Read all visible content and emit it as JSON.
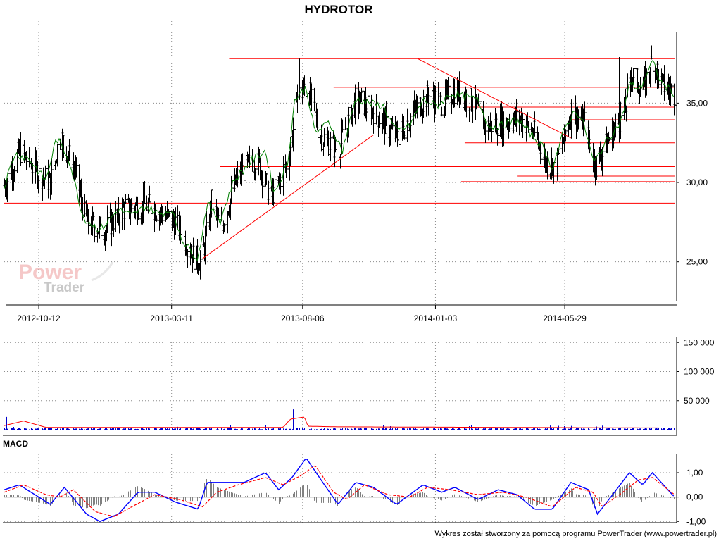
{
  "title": "HYDROTOR",
  "watermark": {
    "brand_top": "Power",
    "brand_bottom": "Trader"
  },
  "footer": "Wykres został stworzony za pomocą programu PowerTrader (www.powertrader.pl)",
  "colors": {
    "trendline": "#ff0000",
    "moving_average": "#008000",
    "bars": "#000000",
    "volume_bars": "#0000cc",
    "volume_average": "#ff0000",
    "macd_line": "#0000ff",
    "macd_signal": "#ff0000",
    "macd_histogram": "#808080"
  },
  "chart_data": [
    {
      "type": "ohlc",
      "title": "HYDROTOR",
      "x_tick_labels": [
        "2012-10-12",
        "2013-03-11",
        "2013-08-06",
        "2014-01-03",
        "2014-05-29"
      ],
      "date_range": [
        "2012-09-03",
        "2014-09-30"
      ],
      "y_tick_labels": [
        "25,00",
        "30,00",
        "35,00"
      ],
      "ylim": [
        22.5,
        39.5
      ],
      "grid": true,
      "moving_average_close": [
        [
          "2012-09-03",
          29.8
        ],
        [
          "2012-09-15",
          31.8
        ],
        [
          "2012-10-01",
          31.5
        ],
        [
          "2012-10-20",
          30.1
        ],
        [
          "2012-11-01",
          32.8
        ],
        [
          "2012-11-15",
          31.5
        ],
        [
          "2012-12-01",
          27.8
        ],
        [
          "2012-12-20",
          27.0
        ],
        [
          "2013-01-10",
          28.3
        ],
        [
          "2013-01-25",
          27.9
        ],
        [
          "2013-02-10",
          28.5
        ],
        [
          "2013-02-25",
          28.0
        ],
        [
          "2013-03-10",
          28.3
        ],
        [
          "2013-03-25",
          26.2
        ],
        [
          "2013-04-10",
          25.2
        ],
        [
          "2013-04-20",
          28.7
        ],
        [
          "2013-05-05",
          27.6
        ],
        [
          "2013-05-20",
          30.1
        ],
        [
          "2013-06-10",
          31.4
        ],
        [
          "2013-06-25",
          32.0
        ],
        [
          "2013-07-05",
          29.3
        ],
        [
          "2013-07-20",
          31.2
        ],
        [
          "2013-07-28",
          35.2
        ],
        [
          "2013-08-10",
          36.0
        ],
        [
          "2013-08-20",
          33.1
        ],
        [
          "2013-09-05",
          33.8
        ],
        [
          "2013-09-20",
          32.0
        ],
        [
          "2013-10-05",
          35.3
        ],
        [
          "2013-10-20",
          35.0
        ],
        [
          "2013-11-05",
          34.8
        ],
        [
          "2013-11-20",
          33.2
        ],
        [
          "2013-12-05",
          33.6
        ],
        [
          "2013-12-20",
          35.2
        ],
        [
          "2014-01-05",
          34.8
        ],
        [
          "2014-01-20",
          35.6
        ],
        [
          "2014-02-05",
          35.4
        ],
        [
          "2014-02-20",
          35.2
        ],
        [
          "2014-03-05",
          33.5
        ],
        [
          "2014-03-20",
          33.6
        ],
        [
          "2014-04-05",
          34.0
        ],
        [
          "2014-04-20",
          33.1
        ],
        [
          "2014-05-05",
          32.2
        ],
        [
          "2014-05-15",
          30.9
        ],
        [
          "2014-05-29",
          33.4
        ],
        [
          "2014-06-10",
          34.6
        ],
        [
          "2014-06-20",
          33.6
        ],
        [
          "2014-07-01",
          31.2
        ],
        [
          "2014-07-15",
          32.6
        ],
        [
          "2014-08-01",
          33.9
        ],
        [
          "2014-08-10",
          36.2
        ],
        [
          "2014-08-22",
          35.9
        ],
        [
          "2014-09-05",
          37.6
        ],
        [
          "2014-09-15",
          36.3
        ],
        [
          "2014-09-30",
          35.6
        ]
      ],
      "ohlc_anchors": [
        [
          "2012-09-03",
          29.8
        ],
        [
          "2012-09-20",
          32.0
        ],
        [
          "2012-10-12",
          30.5
        ],
        [
          "2012-10-25",
          30.0
        ],
        [
          "2012-11-05",
          33.0
        ],
        [
          "2012-11-20",
          31.0
        ],
        [
          "2012-12-05",
          27.5
        ],
        [
          "2012-12-25",
          27.0
        ],
        [
          "2013-01-15",
          28.3
        ],
        [
          "2013-02-10",
          28.6
        ],
        [
          "2013-03-01",
          28.0
        ],
        [
          "2013-03-15",
          27.5
        ],
        [
          "2013-04-05",
          25.3
        ],
        [
          "2013-04-14",
          25.0
        ],
        [
          "2013-04-25",
          28.8
        ],
        [
          "2013-05-05",
          27.0
        ],
        [
          "2013-05-25",
          30.5
        ],
        [
          "2013-06-15",
          31.5
        ],
        [
          "2013-07-01",
          29.0
        ],
        [
          "2013-07-20",
          31.3
        ],
        [
          "2013-08-01",
          35.5
        ],
        [
          "2013-08-12",
          36.0
        ],
        [
          "2013-08-25",
          33.0
        ],
        [
          "2013-09-15",
          32.0
        ],
        [
          "2013-10-05",
          35.3
        ],
        [
          "2013-10-25",
          34.5
        ],
        [
          "2013-11-20",
          32.8
        ],
        [
          "2013-12-10",
          34.5
        ],
        [
          "2013-12-25",
          35.5
        ],
        [
          "2014-01-10",
          35.0
        ],
        [
          "2014-01-25",
          35.8
        ],
        [
          "2014-02-15",
          35.0
        ],
        [
          "2014-03-01",
          33.5
        ],
        [
          "2014-03-20",
          33.8
        ],
        [
          "2014-04-10",
          34.0
        ],
        [
          "2014-04-25",
          33.0
        ],
        [
          "2014-05-10",
          31.0
        ],
        [
          "2014-05-20",
          31.2
        ],
        [
          "2014-06-05",
          34.5
        ],
        [
          "2014-06-20",
          33.8
        ],
        [
          "2014-07-02",
          31.0
        ],
        [
          "2014-07-20",
          33.0
        ],
        [
          "2014-08-05",
          34.5
        ],
        [
          "2014-08-12",
          37.0
        ],
        [
          "2014-08-25",
          35.8
        ],
        [
          "2014-09-05",
          37.8
        ],
        [
          "2014-09-15",
          36.2
        ],
        [
          "2014-09-30",
          35.6
        ]
      ],
      "notable_highs": [
        [
          "2013-08-02",
          37.8
        ],
        [
          "2013-12-14",
          37.8
        ],
        [
          "2013-12-24",
          38.0
        ],
        [
          "2014-07-29",
          37.9
        ],
        [
          "2014-09-06",
          39.3
        ]
      ],
      "notable_lows": [
        [
          "2013-04-14",
          23.0
        ],
        [
          "2014-07-03",
          30.0
        ],
        [
          "2014-05-15",
          30.4
        ]
      ],
      "trendlines": [
        {
          "from": [
            "2013-04-15",
            25.2
          ],
          "to": [
            "2013-10-25",
            33.0
          ]
        },
        {
          "from": [
            "2013-12-14",
            37.8
          ],
          "to": [
            "2014-06-05",
            32.8
          ]
        }
      ],
      "horizontal_lines": [
        {
          "price": 37.8,
          "from": "2013-05-15",
          "to": "2014-09-30"
        },
        {
          "price": 36.0,
          "from": "2013-09-10",
          "to": "2014-09-30"
        },
        {
          "price": 34.75,
          "from": "2014-02-05",
          "to": "2014-09-30"
        },
        {
          "price": 33.95,
          "from": "2014-06-05",
          "to": "2014-09-30"
        },
        {
          "price": 32.5,
          "from": "2014-02-05",
          "to": "2014-09-30"
        },
        {
          "price": 31.0,
          "from": "2013-05-05",
          "to": "2014-09-30"
        },
        {
          "price": 30.4,
          "from": "2014-04-05",
          "to": "2014-09-30"
        },
        {
          "price": 30.05,
          "from": "2014-02-01",
          "to": "2014-09-30"
        },
        {
          "price": 28.7,
          "from": "2012-09-03",
          "to": "2014-09-30"
        }
      ]
    },
    {
      "type": "bar",
      "name": "volume",
      "y_tick_labels": [
        "50 000",
        "100 000",
        "150 000"
      ],
      "ylim": [
        0,
        160000
      ],
      "grid": true,
      "typical_volume": 2000,
      "spikes": [
        [
          "2012-09-05",
          22000
        ],
        [
          "2012-09-09",
          30000
        ],
        [
          "2012-09-15",
          14000
        ],
        [
          "2013-07-24",
          158000
        ],
        [
          "2013-07-26",
          35000
        ],
        [
          "2013-07-28",
          25000
        ],
        [
          "2013-01-20",
          8000
        ],
        [
          "2013-06-15",
          9000
        ],
        [
          "2014-02-10",
          6000
        ],
        [
          "2014-07-10",
          7000
        ]
      ],
      "average_line": [
        [
          "2012-09-03",
          7000
        ],
        [
          "2012-09-25",
          15000
        ],
        [
          "2012-10-20",
          4000
        ],
        [
          "2013-07-15",
          4000
        ],
        [
          "2013-07-23",
          18000
        ],
        [
          "2013-08-08",
          22000
        ],
        [
          "2013-08-12",
          6000
        ],
        [
          "2013-09-15",
          5000
        ],
        [
          "2014-09-30",
          3000
        ]
      ]
    },
    {
      "type": "line",
      "name": "MACD",
      "title": "MACD",
      "y_tick_labels": [
        "1,00",
        "0,00",
        "-1,00"
      ],
      "ylim": [
        -1.05,
        1.75
      ],
      "grid": true,
      "series": [
        {
          "name": "MACD",
          "values": [
            [
              "2012-09-03",
              0.3
            ],
            [
              "2012-09-20",
              0.5
            ],
            [
              "2012-10-12",
              0.0
            ],
            [
              "2012-10-25",
              -0.3
            ],
            [
              "2012-11-10",
              0.4
            ],
            [
              "2012-12-05",
              -0.7
            ],
            [
              "2012-12-20",
              -1.0
            ],
            [
              "2013-01-10",
              -0.7
            ],
            [
              "2013-02-01",
              0.2
            ],
            [
              "2013-02-20",
              0.2
            ],
            [
              "2013-03-15",
              -0.2
            ],
            [
              "2013-04-10",
              -0.5
            ],
            [
              "2013-04-20",
              0.6
            ],
            [
              "2013-05-10",
              0.6
            ],
            [
              "2013-06-01",
              0.6
            ],
            [
              "2013-06-25",
              1.0
            ],
            [
              "2013-07-10",
              0.3
            ],
            [
              "2013-07-25",
              0.8
            ],
            [
              "2013-08-10",
              1.6
            ],
            [
              "2013-08-25",
              0.8
            ],
            [
              "2013-09-15",
              -0.3
            ],
            [
              "2013-10-05",
              0.6
            ],
            [
              "2013-10-25",
              0.4
            ],
            [
              "2013-11-20",
              -0.3
            ],
            [
              "2013-12-20",
              0.5
            ],
            [
              "2014-01-10",
              0.2
            ],
            [
              "2014-01-25",
              0.4
            ],
            [
              "2014-02-20",
              -0.1
            ],
            [
              "2014-03-15",
              0.3
            ],
            [
              "2014-04-05",
              0.1
            ],
            [
              "2014-04-25",
              -0.5
            ],
            [
              "2014-05-15",
              -0.5
            ],
            [
              "2014-06-05",
              0.6
            ],
            [
              "2014-06-25",
              0.3
            ],
            [
              "2014-07-05",
              -0.7
            ],
            [
              "2014-07-20",
              0.0
            ],
            [
              "2014-08-10",
              1.0
            ],
            [
              "2014-08-25",
              0.5
            ],
            [
              "2014-09-05",
              1.0
            ],
            [
              "2014-09-30",
              0.0
            ]
          ]
        },
        {
          "name": "Signal",
          "values": [
            [
              "2012-09-03",
              0.2
            ],
            [
              "2012-09-25",
              0.5
            ],
            [
              "2012-10-20",
              0.1
            ],
            [
              "2012-11-05",
              0.0
            ],
            [
              "2012-11-20",
              0.3
            ],
            [
              "2012-12-15",
              -0.6
            ],
            [
              "2013-01-05",
              -0.8
            ],
            [
              "2013-01-25",
              -0.4
            ],
            [
              "2013-02-20",
              0.1
            ],
            [
              "2013-03-20",
              -0.1
            ],
            [
              "2013-04-15",
              -0.4
            ],
            [
              "2013-05-01",
              0.2
            ],
            [
              "2013-05-25",
              0.5
            ],
            [
              "2013-06-25",
              0.8
            ],
            [
              "2013-07-15",
              0.5
            ],
            [
              "2013-08-05",
              0.9
            ],
            [
              "2013-08-20",
              1.3
            ],
            [
              "2013-09-10",
              0.2
            ],
            [
              "2013-09-25",
              -0.1
            ],
            [
              "2013-10-15",
              0.5
            ],
            [
              "2013-11-10",
              0.1
            ],
            [
              "2013-12-05",
              0.0
            ],
            [
              "2013-12-25",
              0.4
            ],
            [
              "2014-01-20",
              0.3
            ],
            [
              "2014-02-20",
              0.1
            ],
            [
              "2014-03-20",
              0.2
            ],
            [
              "2014-04-15",
              0.0
            ],
            [
              "2014-05-15",
              -0.4
            ],
            [
              "2014-06-10",
              0.4
            ],
            [
              "2014-06-30",
              0.2
            ],
            [
              "2014-07-10",
              -0.4
            ],
            [
              "2014-07-30",
              0.1
            ],
            [
              "2014-08-20",
              0.7
            ],
            [
              "2014-09-05",
              0.8
            ],
            [
              "2014-09-30",
              0.1
            ]
          ]
        }
      ]
    }
  ]
}
